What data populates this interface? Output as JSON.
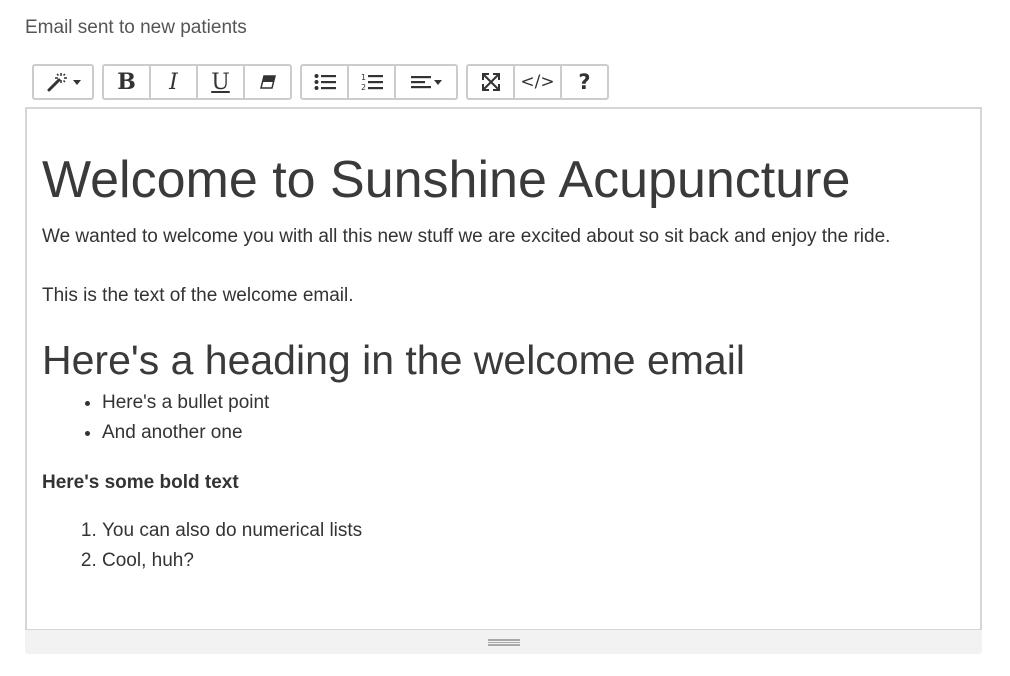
{
  "field": {
    "label": "Email sent to new patients"
  },
  "toolbar": {
    "groups": [
      {
        "name": "style",
        "buttons": [
          {
            "icon": "magic-wand-icon",
            "dropdown": true
          }
        ]
      },
      {
        "name": "font",
        "buttons": [
          {
            "icon": "bold-icon",
            "label": "B"
          },
          {
            "icon": "italic-icon",
            "label": "I"
          },
          {
            "icon": "underline-icon",
            "label": "U"
          },
          {
            "icon": "eraser-icon"
          }
        ]
      },
      {
        "name": "para",
        "buttons": [
          {
            "icon": "bullet-list-icon"
          },
          {
            "icon": "numbered-list-icon"
          },
          {
            "icon": "align-icon",
            "dropdown": true
          }
        ]
      },
      {
        "name": "view",
        "buttons": [
          {
            "icon": "fullscreen-icon"
          },
          {
            "icon": "code-view-icon",
            "label": "</>"
          },
          {
            "icon": "help-icon",
            "label": "?"
          }
        ]
      }
    ],
    "bold_label": "B",
    "italic_label": "I",
    "underline_label": "U",
    "code_label": "</>",
    "help_label": "?"
  },
  "content": {
    "heading1": "Welcome to Sunshine Acupuncture",
    "intro": "We wanted to welcome you with all this new stuff we are excited about so sit back and enjoy the ride.",
    "body": "This is the text of the welcome email.",
    "heading2": "Here's a heading in the welcome email",
    "bullets": [
      "Here's a bullet point",
      "And another one"
    ],
    "bold_text": "Here's some bold text",
    "numbered": [
      "You can also do numerical lists",
      "Cool, huh?"
    ]
  },
  "colors": {
    "text": "#333333",
    "border": "#cccccc",
    "resize_bar": "#f2f2f2"
  }
}
